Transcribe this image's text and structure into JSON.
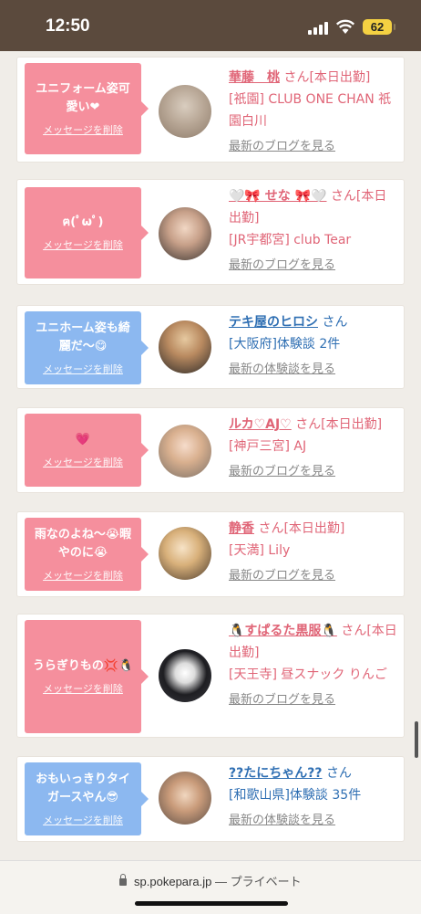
{
  "status_bar": {
    "time": "12:50",
    "battery": "62"
  },
  "delete_label": "メッセージを削除",
  "cards": [
    {
      "type": "cast",
      "bubble": "ユニフォーム姿可愛い❤",
      "name": "華藤　桃",
      "san": "さん[本日出勤]",
      "shop": "[祇園] CLUB ONE CHAN 祇園白川",
      "link": "最新のブログを見る"
    },
    {
      "type": "cast",
      "bubble": "ฅ(ﾟωﾟ)",
      "name": "🤍🎀 せな 🎀🤍",
      "san": "さん[本日出勤]",
      "shop": "[JR宇都宮] club Tear",
      "link": "最新のブログを見る"
    },
    {
      "type": "user",
      "bubble": "ユニホーム姿も綺麗だ〜😋",
      "name": "テキ屋のヒロシ",
      "san": "さん",
      "shop": "[大阪府]体験談 2件",
      "link": "最新の体験談を見る"
    },
    {
      "type": "cast",
      "bubble": "💗",
      "name": "ルカ♡AJ♡",
      "san": "さん[本日出勤]",
      "shop": "[神戸三宮] AJ",
      "link": "最新のブログを見る"
    },
    {
      "type": "cast",
      "bubble": "雨なのよね〜😭暇やのに😭",
      "name": "静香",
      "san": "さん[本日出勤]",
      "shop": "[天満] Lily",
      "link": "最新のブログを見る"
    },
    {
      "type": "cast",
      "bubble": "うらぎりもの💢🐧",
      "name": "🐧すぱるた黒服🐧",
      "san": "さん[本日出勤]",
      "shop": "[天王寺] 昼スナック りんご",
      "link": "最新のブログを見る"
    },
    {
      "type": "user",
      "bubble": "おもいっきりタイガースやん😎",
      "name": "??たにちゃん??",
      "san": "さん",
      "shop": "[和歌山県]体験談 35件",
      "link": "最新の体験談を見る"
    }
  ],
  "bottom_bar": {
    "domain": "sp.pokepara.jp",
    "separator": "—",
    "mode": "プライベート"
  }
}
